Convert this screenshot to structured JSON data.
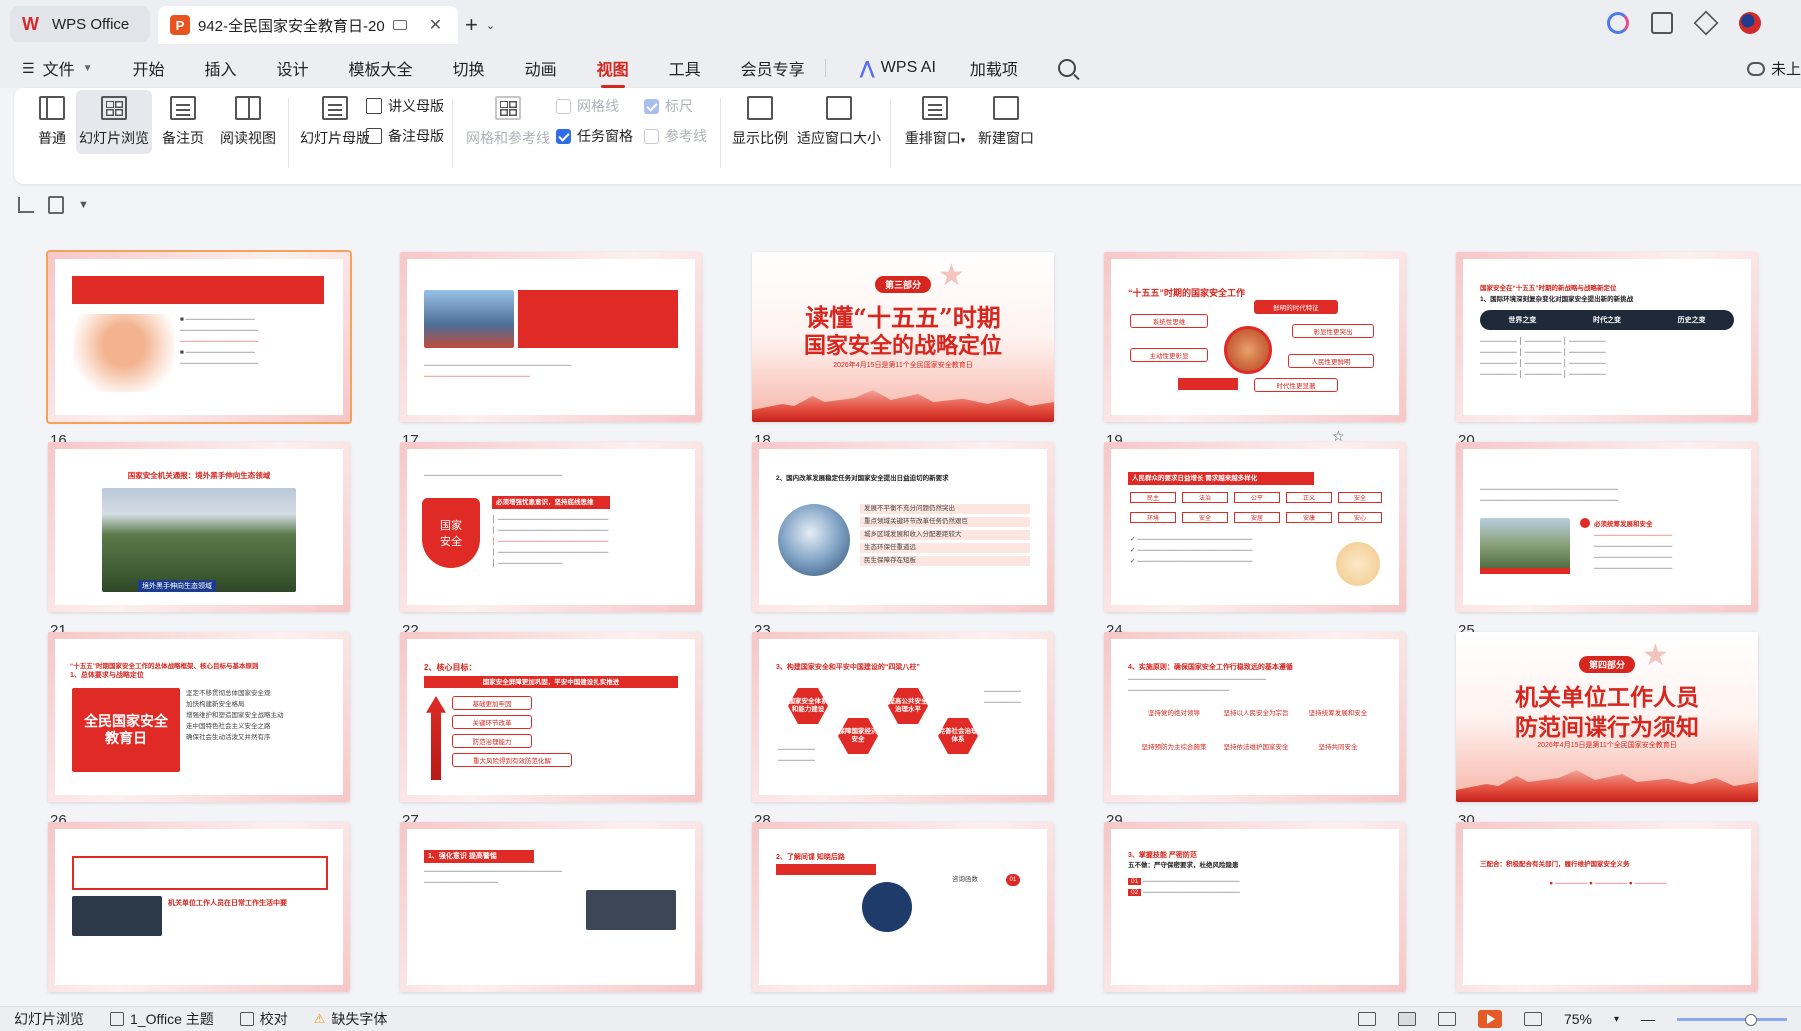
{
  "titlebar": {
    "home_tab": "WPS Office",
    "doc_tab": "942-全民国家安全教育日-20",
    "doc_icon_letter": "P",
    "close_glyph": "✕",
    "new_tab_glyph": "+",
    "chevron": "⌄"
  },
  "menu": {
    "file": "文件",
    "items": [
      "开始",
      "插入",
      "设计",
      "模板大全",
      "切换",
      "动画",
      "视图",
      "工具",
      "会员专享"
    ],
    "active": "视图",
    "ai": "WPS AI",
    "addins": "加载项",
    "cloud": "未上"
  },
  "ribbon": {
    "normal": "普通",
    "slide_sorter": "幻灯片浏览",
    "notes_page": "备注页",
    "reading_view": "阅读视图",
    "slide_master": "幻灯片母版",
    "handout_master": "讲义母版",
    "notes_master": "备注母版",
    "grid_guides": "网格和参考线",
    "gridlines": "网格线",
    "ruler": "标尺",
    "task_pane": "任务窗格",
    "guides": "参考线",
    "zoom": "显示比例",
    "fit_window": "适应窗口大小",
    "arrange": "重排窗口",
    "new_window": "新建窗口"
  },
  "slides": [
    {
      "num": "16",
      "selected": true
    },
    {
      "num": "17"
    },
    {
      "num": "18",
      "badge": "第三部分",
      "title1": "读懂“十五五”时期",
      "title2": "国家安全的战略定位",
      "sub": "2026年4月15日是第11个全民国家安全教育日"
    },
    {
      "num": "19",
      "title": "“十五五”时期的国家安全工作",
      "tags": [
        "系统性思维",
        "鲜明的时代特征",
        "彰显性更突出",
        "主动性更彰显",
        "人民性更鲜明",
        "时代性更显著"
      ]
    },
    {
      "num": "20",
      "title": "国家安全在“十五五”时期的新战略与战略新定位",
      "sub": "1、国际环境深刻复杂变化对国家安全提出新的新挑战",
      "cols": [
        "世界之变",
        "时代之变",
        "历史之变"
      ]
    },
    {
      "num": "21",
      "title": "国家安全机关通报：境外黑手伸向生态领域",
      "caption": "境外黑手伸向生态领域"
    },
    {
      "num": "22",
      "shield": "国家\n安全",
      "bar": "必须增强忧患意识，坚持底线思维"
    },
    {
      "num": "23",
      "title": "2、国内改革发展稳定任务对国家安全提出日益迫切的新要求",
      "items": [
        "发展不平衡不充分问题仍然突出",
        "重点领域关键环节改革任务仍然艰巨",
        "城乡区域发展和收入分配差距较大",
        "生态环保任重道远",
        "民生保障存在短板"
      ]
    },
    {
      "num": "24",
      "bar": "人民群众的要求日益增长 需求越来越多样化",
      "cells": [
        "民主",
        "法治",
        "公平",
        "正义",
        "安全",
        "环境",
        "安全",
        "安居",
        "安康",
        "安心"
      ]
    },
    {
      "num": "25",
      "bar": "必须统筹发展和安全"
    },
    {
      "num": "26",
      "title": "“十五五”时期国家安全工作的总体战略框架、核心目标与基本原则",
      "sub": "1、总体要求与战略定位",
      "img_text": "全民国家安全教育日",
      "items": [
        "坚定不移贯彻总体国家安全观",
        "加快构建新安全格局",
        "增强维护和塑造国家安全战略主动",
        "走中国特色社会主义安全之路",
        "确保社会生动活泼又井然有序"
      ]
    },
    {
      "num": "27",
      "title": "2、核心目标：",
      "bar": "国家安全屏障更加巩固，平安中国建设扎实推进",
      "items": [
        "基础更加牢固",
        "关键环节改革",
        "防范治理能力",
        "重大风险得到有效防范化解"
      ]
    },
    {
      "num": "28",
      "title": "3、构建国家安全和平安中国建设的“四梁八柱”",
      "hexes": [
        "国家安全体系和能力建设",
        "保障国家经济安全",
        "提高公共安全治理水平",
        "完善社会治理体系"
      ]
    },
    {
      "num": "29",
      "title": "4、实施原则：确保国家安全工作行稳致远的基本遵循",
      "items": [
        "坚持党的绝对领导",
        "坚持以人民安全为宗旨",
        "坚持统筹发展和安全",
        "坚持预防为主综合施策",
        "坚持依法维护国家安全",
        "坚持共同安全"
      ]
    },
    {
      "num": "30",
      "badge": "第四部分",
      "title1": "机关单位工作人员",
      "title2": "防范间谍行为须知",
      "sub": "2026年4月15日是第11个全民国家安全教育日"
    },
    {
      "num": "31",
      "title": "机关单位工作人员在日常工作生活中要"
    },
    {
      "num": "32",
      "title": "1、强化意识 提高警惕"
    },
    {
      "num": "33",
      "title": "2、了解间谍 知晓后路",
      "tag": "咨询函数",
      "tag_num": "01"
    },
    {
      "num": "34",
      "title": "3、掌握技能 严密防范",
      "sub": "五不做：严守保密要求，杜绝风险隐患"
    },
    {
      "num": "35",
      "title": "三配合：积极配合有关部门，履行维护国家安全义务"
    }
  ],
  "status": {
    "view": "幻灯片浏览",
    "theme": "1_Office 主题",
    "proof": "校对",
    "missing_font": "缺失字体",
    "zoom": "75%"
  },
  "colors": {
    "accent": "#d7261e",
    "slide_red": "#e02a25"
  }
}
